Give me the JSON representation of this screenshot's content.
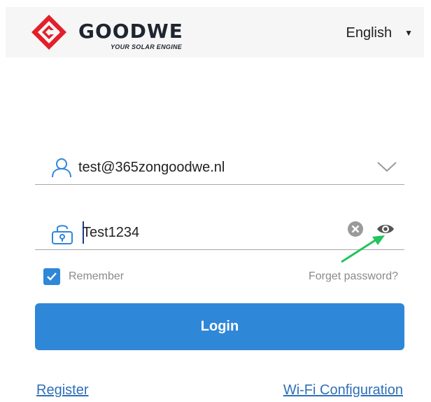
{
  "header": {
    "brand_name": "GOODWE",
    "brand_tagline": "YOUR SOLAR ENGINE",
    "language": "English"
  },
  "login_form": {
    "email_value": "test@365zongoodwe.nl",
    "password_value": "Test1234",
    "remember_label": "Remember",
    "remember_checked": true,
    "forgot_label": "Forget password?",
    "login_label": "Login"
  },
  "footer": {
    "register_label": "Register",
    "wifi_label": "Wi-Fi Configuration"
  },
  "icons": {
    "user": "user-icon",
    "lock": "lock-icon",
    "clear": "clear-icon",
    "eye": "eye-icon",
    "chevron": "chevron-down-icon",
    "check": "check-icon"
  },
  "colors": {
    "accent": "#2f87d8",
    "logo_red": "#e2202a",
    "link": "#2f6fb8",
    "annotation": "#22c55e"
  }
}
